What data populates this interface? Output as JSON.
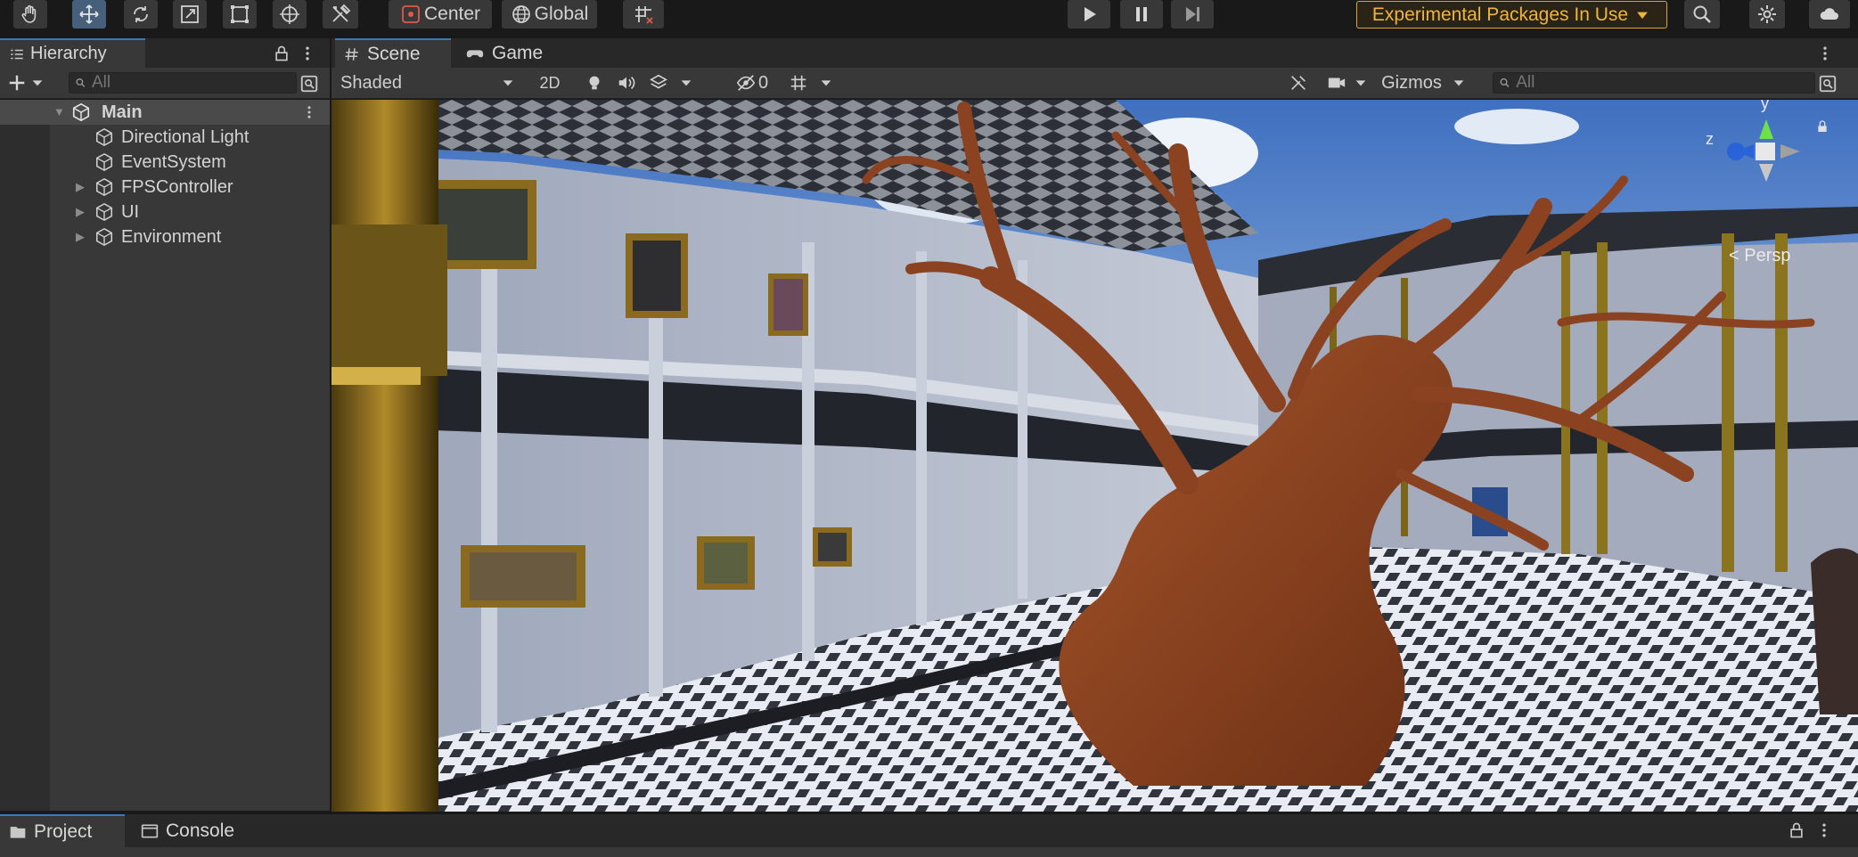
{
  "toolbar": {
    "tools": [
      {
        "name": "hand-tool",
        "icon": "hand-icon"
      },
      {
        "name": "move-tool",
        "icon": "move-icon",
        "active": true
      },
      {
        "name": "rotate-tool",
        "icon": "rotate-icon"
      },
      {
        "name": "scale-tool",
        "icon": "scale-icon"
      },
      {
        "name": "rect-tool",
        "icon": "rect-icon"
      },
      {
        "name": "transform-tool",
        "icon": "transform-icon"
      },
      {
        "name": "custom-tool",
        "icon": "tools-icon"
      }
    ],
    "pivot_mode": "Center",
    "pivot_rotation": "Global",
    "experimental_label": "Experimental Packages In Use",
    "accent_color": "#e0a531"
  },
  "hierarchy": {
    "tab_label": "Hierarchy",
    "search_placeholder": "All",
    "scene_name": "Main",
    "items": [
      {
        "label": "Directional Light",
        "expandable": false
      },
      {
        "label": "EventSystem",
        "expandable": false
      },
      {
        "label": "FPSController",
        "expandable": true
      },
      {
        "label": "UI",
        "expandable": true
      },
      {
        "label": "Environment",
        "expandable": true
      }
    ]
  },
  "scene": {
    "tabs": [
      "Scene",
      "Game"
    ],
    "shading_mode": "Shaded",
    "mode_2d": "2D",
    "hidden_count": "0",
    "gizmos_label": "Gizmos",
    "search_placeholder": "All",
    "gizmo_axis_y": "y",
    "gizmo_axis_z": "z",
    "projection_label": "< Persp"
  },
  "bottom": {
    "tabs": [
      "Project",
      "Console"
    ]
  }
}
